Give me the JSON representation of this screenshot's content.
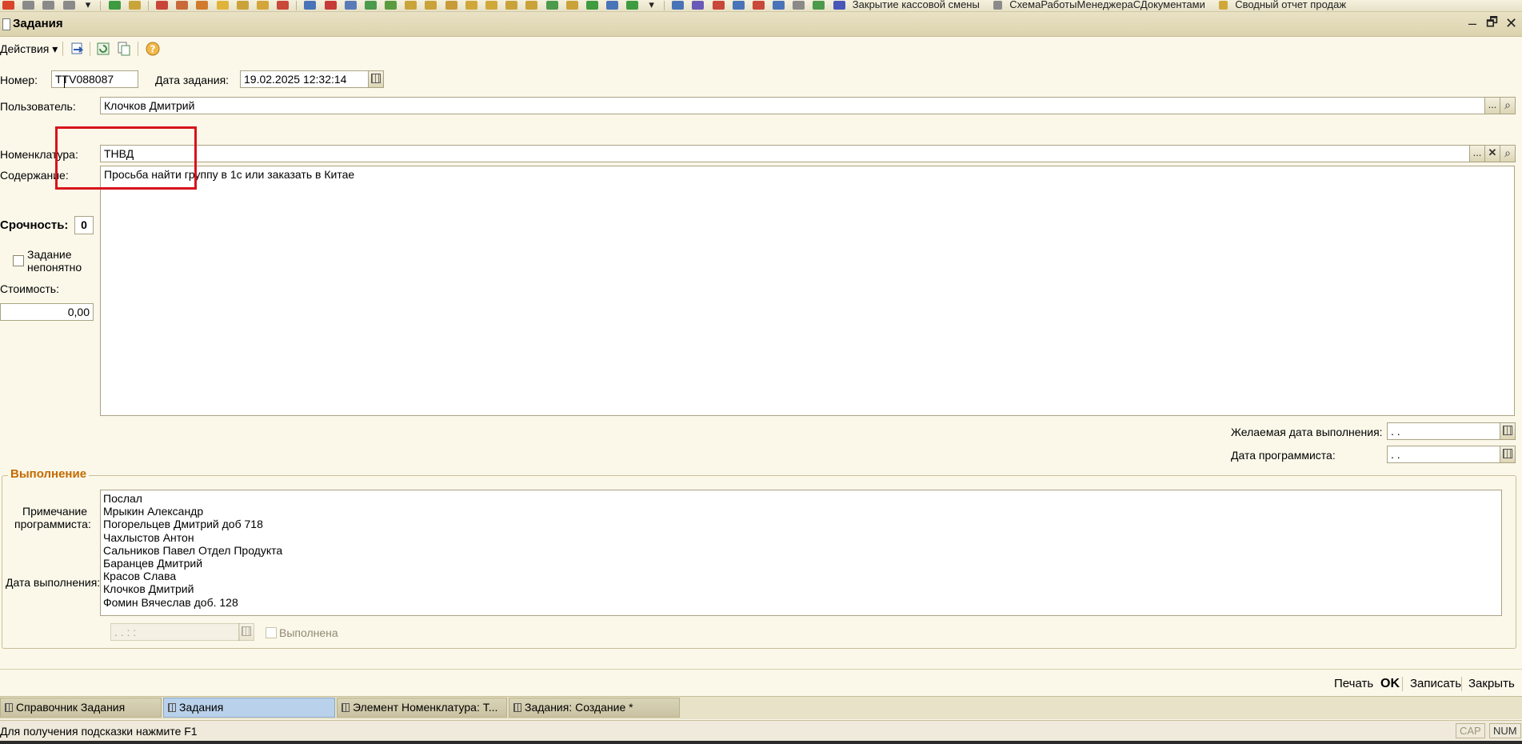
{
  "toolbar": {
    "links": [
      "Закрытие кассовой смены",
      "СхемаРаботыМенеджераСДокументами",
      "Сводный отчет продаж"
    ]
  },
  "window": {
    "title": "Задания",
    "minimize": "–",
    "restore": "🗗",
    "close": "✕"
  },
  "actions": {
    "menu_label": "Действия ▾"
  },
  "form": {
    "number_label": "Номер:",
    "number_value": "TTV088087",
    "date_label": "Дата задания:",
    "date_value": "19.02.2025 12:32:14",
    "user_label": "Пользователь:",
    "user_value": "Клочков Дмитрий",
    "nomenclature_label": "Номенклатура:",
    "nomenclature_value": "ТНВД",
    "content_label": "Содержание:",
    "content_value": "Просьба найти группу в 1с или заказать в Китае",
    "urgency_label": "Срочность:",
    "urgency_value": "0",
    "unclear_line1": "Задание",
    "unclear_line2": "непонятно",
    "cost_label": "Стоимость:",
    "cost_value": "0,00",
    "desired_date_label": "Желаемая дата выполнения:",
    "desired_date_value": " .  . ",
    "programmer_date_label": "Дата программиста:",
    "programmer_date_value": " .  . ",
    "ellipsis": "...",
    "clear": "✕"
  },
  "execution": {
    "group_title": "Выполнение",
    "note_label_line1": "Примечание",
    "note_label_line2": "программиста:",
    "done_date_label": "Дата выполнения:",
    "notes": [
      "Послал",
      "Мрыкин Александр",
      "Погорельцев Дмитрий доб 718",
      "Чахлыстов Антон",
      "Сальников Павел Отдел Продукта",
      "Баранцев Дмитрий",
      "Красов Слава",
      "Клочков Дмитрий",
      "Фомин Вячеслав доб. 128"
    ],
    "done_date_value": " .  .     :  : ",
    "done_label": "Выполнена"
  },
  "commands": {
    "print": "Печать",
    "ok": "OK",
    "save": "Записать",
    "close": "Закрыть"
  },
  "taskbar": {
    "tabs": [
      "Справочник Задания",
      "Задания",
      "Элемент Номенклатура: Т...",
      "Задания: Создание *"
    ]
  },
  "status": {
    "hint": "Для получения подсказки нажмите F1",
    "cap": "CAP",
    "num": "NUM"
  }
}
